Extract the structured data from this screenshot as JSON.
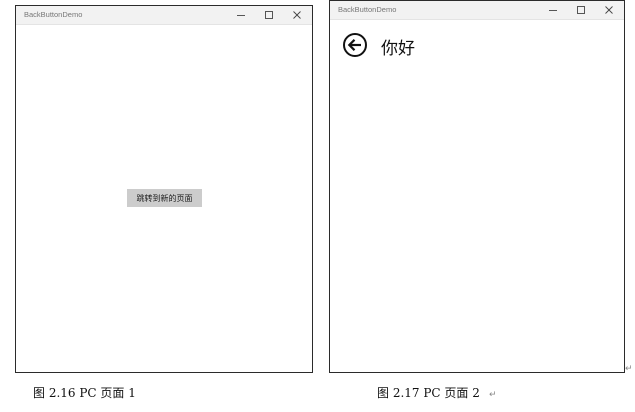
{
  "figure_left": {
    "window": {
      "title": "BackButtonDemo"
    },
    "navigate_button_label": "跳转到新的页面",
    "caption": "图 2.16  PC 页面 1"
  },
  "figure_right": {
    "window": {
      "title": "BackButtonDemo"
    },
    "page_heading": "你好",
    "caption": "图 2.17  PC 页面 2"
  },
  "icons": {
    "minimize": "minimize-icon",
    "maximize": "maximize-icon",
    "close": "close-icon",
    "back": "back-arrow-circle-icon",
    "paragraph_mark": "return-arrow-icon"
  },
  "marks": {
    "paragraph_mark": "↵"
  },
  "colors": {
    "titlebar_bg": "#f2f2f2",
    "button_bg": "#cccccc",
    "window_border": "#2b2b2b"
  }
}
